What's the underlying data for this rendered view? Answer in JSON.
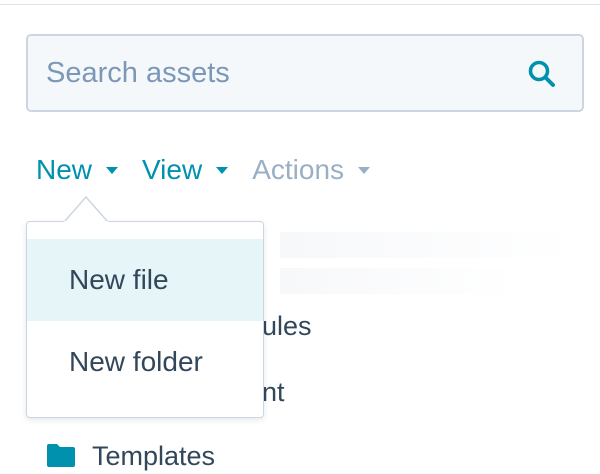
{
  "search": {
    "placeholder": "Search assets",
    "icon": "search-icon"
  },
  "toolbar": {
    "items": [
      {
        "label": "New",
        "enabled": true
      },
      {
        "label": "View",
        "enabled": true
      },
      {
        "label": "Actions",
        "enabled": false
      }
    ]
  },
  "dropdown": {
    "items": [
      {
        "label": "New file",
        "highlighted": true
      },
      {
        "label": "New folder",
        "highlighted": false
      }
    ]
  },
  "file_list": {
    "items": [
      {
        "label_visible_fragment": "ules",
        "icon": "folder-icon"
      },
      {
        "label_visible_fragment": "nt",
        "icon": "folder-icon"
      },
      {
        "label": "Templates",
        "icon": "folder-icon"
      }
    ]
  },
  "colors": {
    "accent": "#0091ae",
    "text": "#33475b",
    "disabled": "#99afc4",
    "placeholder": "#7c98b6",
    "highlight": "#e5f5f8",
    "border": "#cbd6e2",
    "input_bg": "#f5f8fa"
  }
}
